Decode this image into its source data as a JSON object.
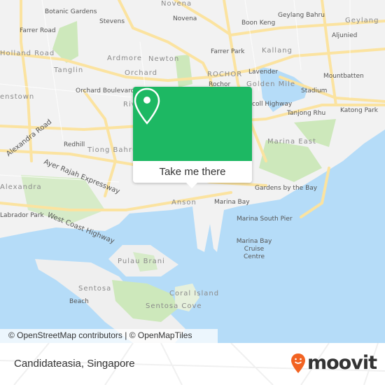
{
  "map": {
    "labels": {
      "novena_top": "Novena",
      "botanic_gardens": "Botanic Gardens",
      "stevens": "Stevens",
      "novena": "Novena",
      "geylang_bahru": "Geylang Bahru",
      "boon_keng": "Boon Keng",
      "geylang": "Geylang",
      "aljunied": "Aljunied",
      "farrer_road": "Farrer Road",
      "holland_road": "Holland Road",
      "ardmore": "Ardmore",
      "newton": "Newton",
      "farrer_park": "Farrer Park",
      "kallang": "Kallang",
      "tanglin": "Tanglin",
      "orchard": "Orchard",
      "rochor_district": "ROCHOR",
      "lavender": "Lavender",
      "mountbatten": "Mountbatten",
      "orchard_boulevard": "Orchard Boulevard",
      "rochor": "Rochor",
      "golden_mile": "Golden Mile",
      "stadium": "Stadium",
      "queenstown": "enstown",
      "nicoll_highway": "coll Highway",
      "tanjong_rhu": "Tanjong Rhu",
      "katong_park": "Katong Park",
      "river": "Riv",
      "alexandra_road": "Alexandra Road",
      "redhill": "Redhill",
      "tiong_bahru": "Tiong Bahru",
      "marina_east": "Marina East",
      "ayer_rajah": "Ayer Rajah Expressway",
      "alexandra": "Alexandra",
      "gardens_by_the_bay": "Gardens by the Bay",
      "labrador_park": "Labrador Park",
      "anson": "Anson",
      "marina_bay": "Marina Bay",
      "west_coast_highway": "West Coast Highway",
      "marina_south_pier": "Marina South Pier",
      "marina_bay_cruise_centre": "Marina Bay Cruise Centre",
      "pulau_brani": "Pulau Brani",
      "sentosa": "Sentosa",
      "beach": "Beach",
      "coral_island": "Coral Island",
      "sentosa_cove": "Sentosa Cove"
    },
    "colors": {
      "land": "#f2f2f2",
      "sea": "#b5dcf8",
      "road": "#fbe7a3",
      "park": "#c8e6b4"
    }
  },
  "popup": {
    "button_label": "Take me there",
    "icon": "map-pin-icon",
    "color": "#1db863"
  },
  "attribution": "© OpenStreetMap contributors | © OpenMapTiles",
  "footer": {
    "place": "Candidateasia, Singapore",
    "brand": "moovit",
    "brand_color": "#f26322"
  }
}
